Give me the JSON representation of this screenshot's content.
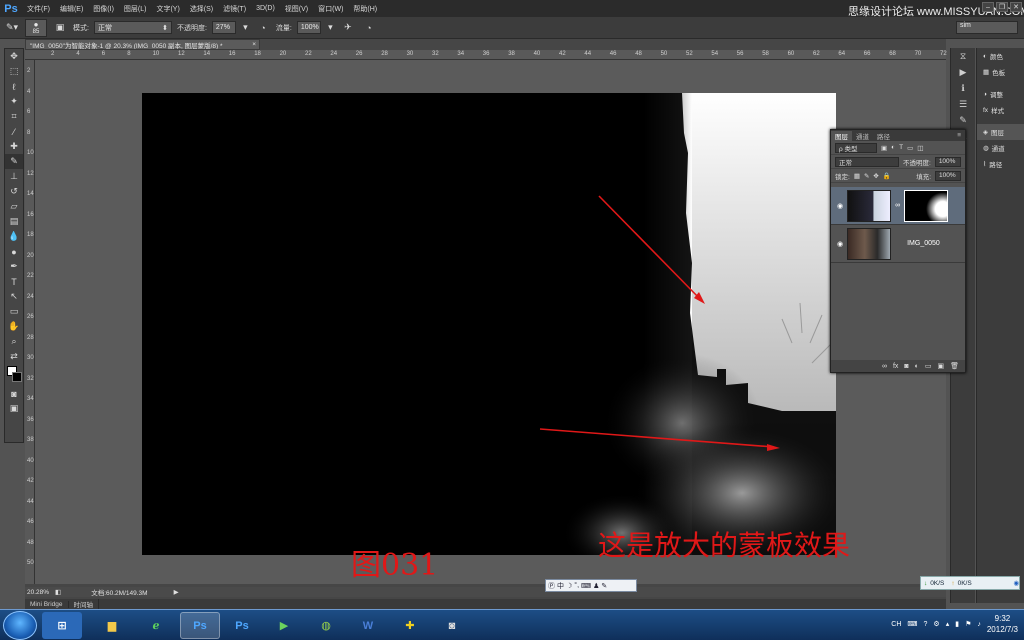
{
  "app": {
    "logo": "Ps"
  },
  "menu": {
    "items": [
      "文件(F)",
      "编辑(E)",
      "图像(I)",
      "图层(L)",
      "文字(Y)",
      "选择(S)",
      "滤镜(T)",
      "3D(D)",
      "视图(V)",
      "窗口(W)",
      "帮助(H)"
    ]
  },
  "watermark": "思缘设计论坛 www.MISSYUAN.COM",
  "options": {
    "brush_size": "85",
    "mode_label": "模式:",
    "mode_value": "正常",
    "opacity_label": "不透明度:",
    "opacity_value": "27%",
    "flow_label": "流量:",
    "flow_value": "100%",
    "workspace": "sim"
  },
  "document": {
    "tab_title": "\"IMG_0050\"为智能对象-1 @ 20.3% (IMG_0050 副本, 图层蒙版/8) *",
    "close": "×",
    "zoom": "20.28%",
    "doc_size": "文档:60.2M/149.3M"
  },
  "ruler": {
    "h": [
      "2",
      "4",
      "6",
      "8",
      "10",
      "12",
      "14",
      "16",
      "18",
      "20",
      "22",
      "24",
      "26",
      "28",
      "30",
      "32",
      "34",
      "36",
      "38",
      "40",
      "42",
      "44",
      "46",
      "48",
      "50",
      "52",
      "54",
      "56",
      "58",
      "60",
      "62",
      "64",
      "66",
      "68",
      "70",
      "72"
    ],
    "v": [
      "2",
      "4",
      "6",
      "8",
      "10",
      "12",
      "14",
      "16",
      "18",
      "20",
      "22",
      "24",
      "26",
      "28",
      "30",
      "32",
      "34",
      "36",
      "38",
      "40",
      "42",
      "44",
      "46",
      "48",
      "50"
    ]
  },
  "bottom_tabs": [
    "Mini Bridge",
    "时间轴"
  ],
  "dock": {
    "rows": [
      {
        "icon": "palette-icon",
        "glyph": "◐",
        "label": "颜色"
      },
      {
        "icon": "swatches-icon",
        "glyph": "▦",
        "label": "色板"
      },
      {
        "icon": "adjustments-icon",
        "glyph": "◑",
        "label": "调整"
      },
      {
        "icon": "styles-icon",
        "glyph": "fx",
        "label": "样式"
      },
      {
        "icon": "layers-icon",
        "glyph": "◈",
        "label": "图层"
      },
      {
        "icon": "channels-icon",
        "glyph": "◍",
        "label": "通道"
      },
      {
        "icon": "paths-icon",
        "glyph": "⌇",
        "label": "路径"
      }
    ]
  },
  "layers": {
    "tabs": [
      "图层",
      "通道",
      "路径"
    ],
    "filter_label": "ρ 类型",
    "blend_mode": "正常",
    "opacity_label": "不透明度:",
    "opacity_value": "100%",
    "lock_label": "锁定:",
    "fill_label": "填充:",
    "fill_value": "100%",
    "items": [
      {
        "name": "",
        "has_mask": true
      },
      {
        "name": "IMG_0050",
        "has_mask": false
      }
    ]
  },
  "captions": {
    "figure": "图031",
    "note": "这是放大的蒙板效果"
  },
  "ime": {
    "items": [
      "中",
      "☽",
      "°,",
      "⌨",
      "♟",
      "✎"
    ]
  },
  "net": {
    "down": "0K/S",
    "up": "0K/S"
  },
  "tray": {
    "lang": "CH",
    "time": "9:32",
    "date": "2012/7/3"
  },
  "colors": {
    "arrow": "#e01818",
    "caption": "#e01818"
  }
}
